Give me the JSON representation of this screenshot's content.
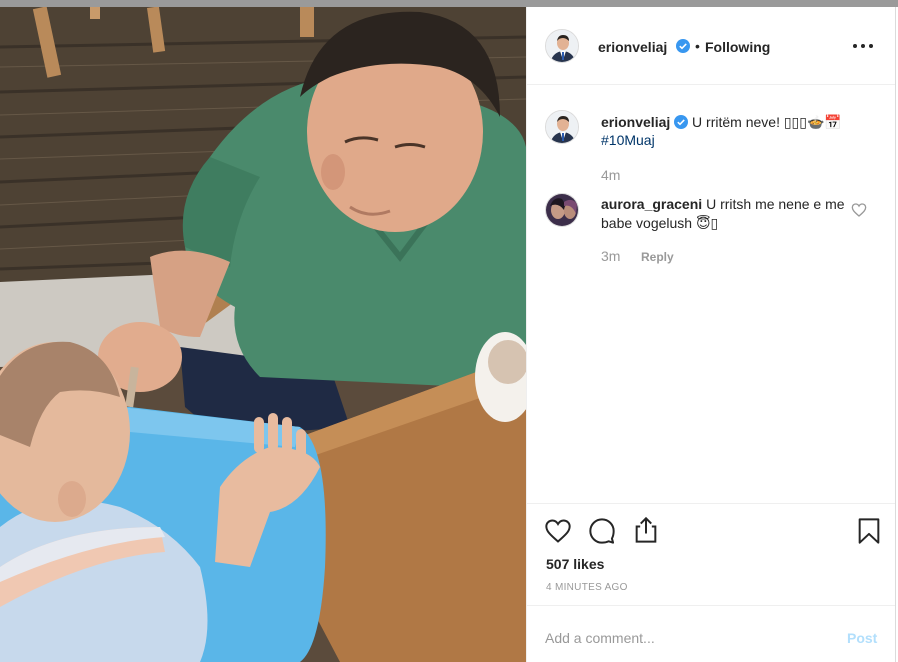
{
  "post": {
    "author": "erionveliaj",
    "follow_status": "Following",
    "separator": "•",
    "verified": true
  },
  "comments": [
    {
      "username": "erionveliaj",
      "text": "U rritëm neve! ▯▯▯🍲📅",
      "hashtag": "#10Muaj",
      "time": "4m"
    },
    {
      "username": "aurora_graceni",
      "text": "U rritsh me nene e me babe vogelush 😇▯",
      "time": "3m",
      "reply_label": "Reply"
    }
  ],
  "actions": {
    "likes": "507 likes",
    "posted": "4 MINUTES AGO"
  },
  "add_comment": {
    "placeholder": "Add a comment...",
    "post_label": "Post"
  },
  "colors": {
    "accent_blue": "#3897f0",
    "hashtag": "#003569",
    "muted": "#999999",
    "post_disabled": "#b2dffc",
    "shirt_green": "#4a8a6c",
    "chair_blue": "#5ab6e8"
  },
  "icons": [
    "verified-icon",
    "more-options-icon",
    "heart-icon",
    "comment-icon",
    "share-icon",
    "bookmark-icon"
  ]
}
